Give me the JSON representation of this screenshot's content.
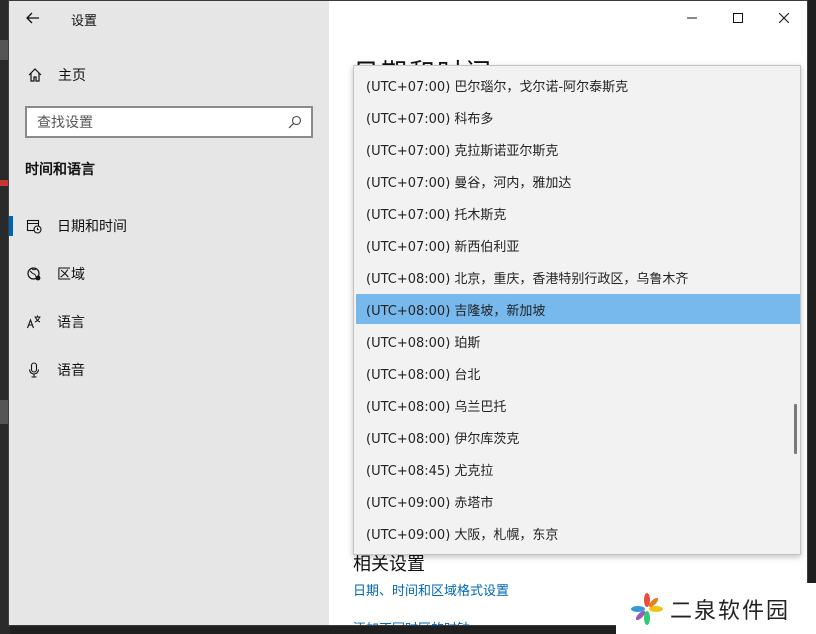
{
  "app": {
    "title": "设置"
  },
  "sidebar": {
    "home_label": "主页",
    "search_placeholder": "查找设置",
    "section_title": "时间和语言",
    "items": [
      {
        "label": "日期和时间",
        "icon": "calendar-clock-icon",
        "active": true
      },
      {
        "label": "区域",
        "icon": "globe-region-icon",
        "active": false
      },
      {
        "label": "语言",
        "icon": "language-icon",
        "active": false
      },
      {
        "label": "语音",
        "icon": "microphone-icon",
        "active": false
      }
    ]
  },
  "main": {
    "page_title": "日期和时间",
    "timezone_dropdown": {
      "options": [
        "(UTC+07:00) 巴尔瑙尔，戈尔诺-阿尔泰斯克",
        "(UTC+07:00) 科布多",
        "(UTC+07:00) 克拉斯诺亚尔斯克",
        "(UTC+07:00) 曼谷，河内，雅加达",
        "(UTC+07:00) 托木斯克",
        "(UTC+07:00) 新西伯利亚",
        "(UTC+08:00) 北京，重庆，香港特别行政区，乌鲁木齐",
        "(UTC+08:00) 吉隆坡，新加坡",
        "(UTC+08:00) 珀斯",
        "(UTC+08:00) 台北",
        "(UTC+08:00) 乌兰巴托",
        "(UTC+08:00) 伊尔库茨克",
        "(UTC+08:45) 尤克拉",
        "(UTC+09:00) 赤塔市",
        "(UTC+09:00) 大阪，札幌，东京"
      ],
      "selected": "(UTC+08:00) 吉隆坡，新加坡"
    },
    "related_title": "相关设置",
    "links": [
      "日期、时间和区域格式设置",
      "添加不同时区的时钟"
    ]
  },
  "watermark": {
    "text": "二泉软件园"
  },
  "colors": {
    "accent": "#0063b1",
    "selected_bg": "#77b9ec",
    "link": "#0067b8",
    "sidebar_bg": "#e6e6e6"
  }
}
